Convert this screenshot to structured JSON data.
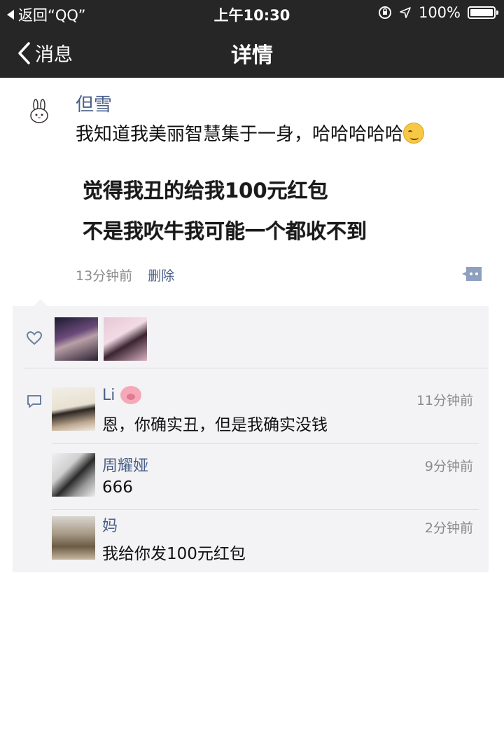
{
  "status_bar": {
    "back_label": "返回“QQ”",
    "time": "上午10:30",
    "battery": "100%"
  },
  "nav": {
    "back_label": "消息",
    "title": "详情"
  },
  "post": {
    "author": "但雪",
    "text": "我知道我美丽智慧集于一身，哈哈哈哈哈",
    "image_line1": "觉得我丑的给我100元红包",
    "image_line2": "不是我吹牛我可能一个都收不到",
    "time": "13分钟前",
    "delete_label": "删除"
  },
  "comments": [
    {
      "name": "Li",
      "time": "11分钟前",
      "text": "恩，你确实丑，但是我确实没钱"
    },
    {
      "name": "周耀娅",
      "time": "9分钟前",
      "text": "666"
    },
    {
      "name": "妈",
      "time": "2分钟前",
      "text": "我给你发100元红包"
    }
  ]
}
